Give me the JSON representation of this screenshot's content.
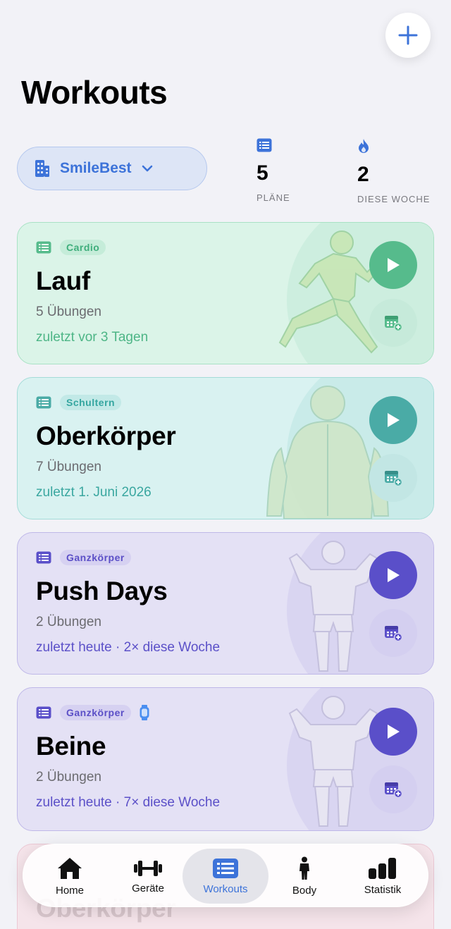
{
  "header": {
    "title": "Workouts",
    "add_icon": "plus-icon"
  },
  "gym": {
    "name": "SmileBest"
  },
  "stats": [
    {
      "value": "5",
      "label": "PLÄNE",
      "icon": "list-icon"
    },
    {
      "value": "2",
      "label": "DIESE WOCHE",
      "icon": "flame-icon"
    }
  ],
  "colors": {
    "accent": "#3d73d9",
    "green": "#56bb8c",
    "teal": "#4aaba6",
    "purple": "#5a4fc9"
  },
  "workouts": [
    {
      "tag": "Cardio",
      "title": "Lauf",
      "count": "5 Übungen",
      "last": "zuletzt vor 3 Tagen"
    },
    {
      "tag": "Schultern",
      "title": "Oberkörper",
      "count": "7 Übungen",
      "last": "zuletzt 1. Juni 2026"
    },
    {
      "tag": "Ganzkörper",
      "title": "Push Days",
      "count": "2 Übungen",
      "last": "zuletzt heute · 2× diese Woche"
    },
    {
      "tag": "Ganzkörper",
      "title": "Beine",
      "count": "2 Übungen",
      "last": "zuletzt heute · 7× diese Woche",
      "watch_icon": "watch-icon"
    },
    {
      "title": "Oberkörper"
    }
  ],
  "tabs": [
    {
      "label": "Home",
      "icon": "home-icon"
    },
    {
      "label": "Geräte",
      "icon": "dumbbell-icon"
    },
    {
      "label": "Workouts",
      "icon": "list-icon",
      "active": true
    },
    {
      "label": "Body",
      "icon": "person-icon"
    },
    {
      "label": "Statistik",
      "icon": "bar-chart-icon"
    }
  ]
}
